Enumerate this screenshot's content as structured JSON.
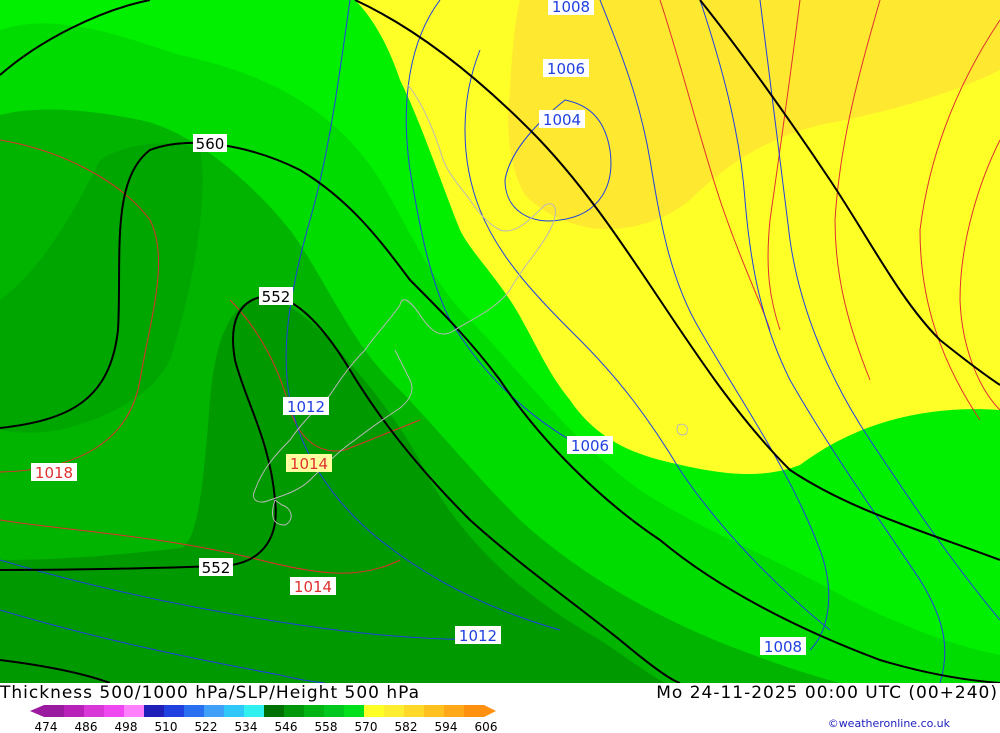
{
  "title_left": "Thickness 500/1000 hPa/SLP/Height 500 hPa",
  "title_right": "Mo 24-11-2025 00:00 UTC (00+240)",
  "credit": "©weatheronline.co.uk",
  "legend": {
    "ticks": [
      "474",
      "486",
      "498",
      "510",
      "522",
      "534",
      "546",
      "558",
      "570",
      "582",
      "594",
      "606"
    ],
    "colors": [
      "#9a1aa0",
      "#b822b8",
      "#d838d8",
      "#f048f0",
      "#ff80ff",
      "#2020b8",
      "#2040e0",
      "#2870f0",
      "#40a0f8",
      "#30c8f8",
      "#30f0f0",
      "#007000",
      "#00980a",
      "#00b414",
      "#00c81e",
      "#00e01c",
      "#ffff28",
      "#ffee30",
      "#ffd828",
      "#ffc020",
      "#ffa818",
      "#ff9010"
    ]
  },
  "labels": {
    "geopotential": [
      "560",
      "552",
      "552"
    ],
    "slp_blue": [
      "1008",
      "1006",
      "1004",
      "1006",
      "1012",
      "1012",
      "1008"
    ],
    "slp_red": [
      "1018",
      "1014",
      "1014"
    ]
  },
  "colors": {
    "green_dark": "#009a00",
    "green_mid": "#00b400",
    "green_light": "#00dc00",
    "green_bright": "#00f000",
    "yellow": "#ffff28",
    "yellow_warm": "#ffe830",
    "isobar_blue": "#2040e0",
    "isobar_red": "#e03030",
    "height_black": "#000000"
  }
}
